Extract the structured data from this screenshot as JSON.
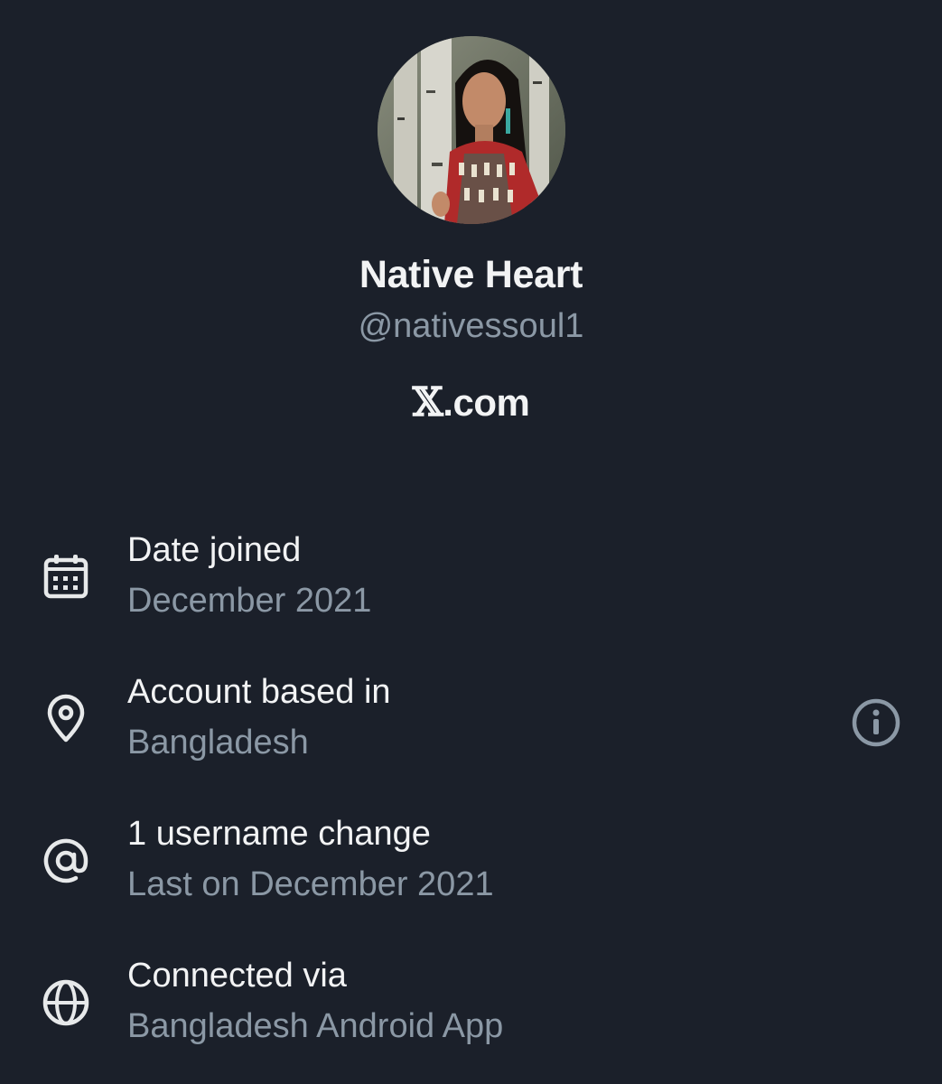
{
  "profile": {
    "display_name": "Native Heart",
    "handle": "@nativessoul1",
    "site_prefix": "𝕏",
    "site_suffix": ".com"
  },
  "about": {
    "rows": [
      {
        "icon": "calendar-icon",
        "title": "Date joined",
        "value": "December 2021"
      },
      {
        "icon": "location-pin-icon",
        "title": "Account based in",
        "value": "Bangladesh"
      },
      {
        "icon": "at-sign-icon",
        "title": "1 username change",
        "value": "Last on December 2021"
      },
      {
        "icon": "globe-icon",
        "title": "Connected via",
        "value": "Bangladesh Android App"
      }
    ],
    "info_icon": "info-circle-icon"
  },
  "colors": {
    "background": "#1b202a",
    "primary_text": "#f2f3f4",
    "secondary_text": "#8b98a5"
  }
}
